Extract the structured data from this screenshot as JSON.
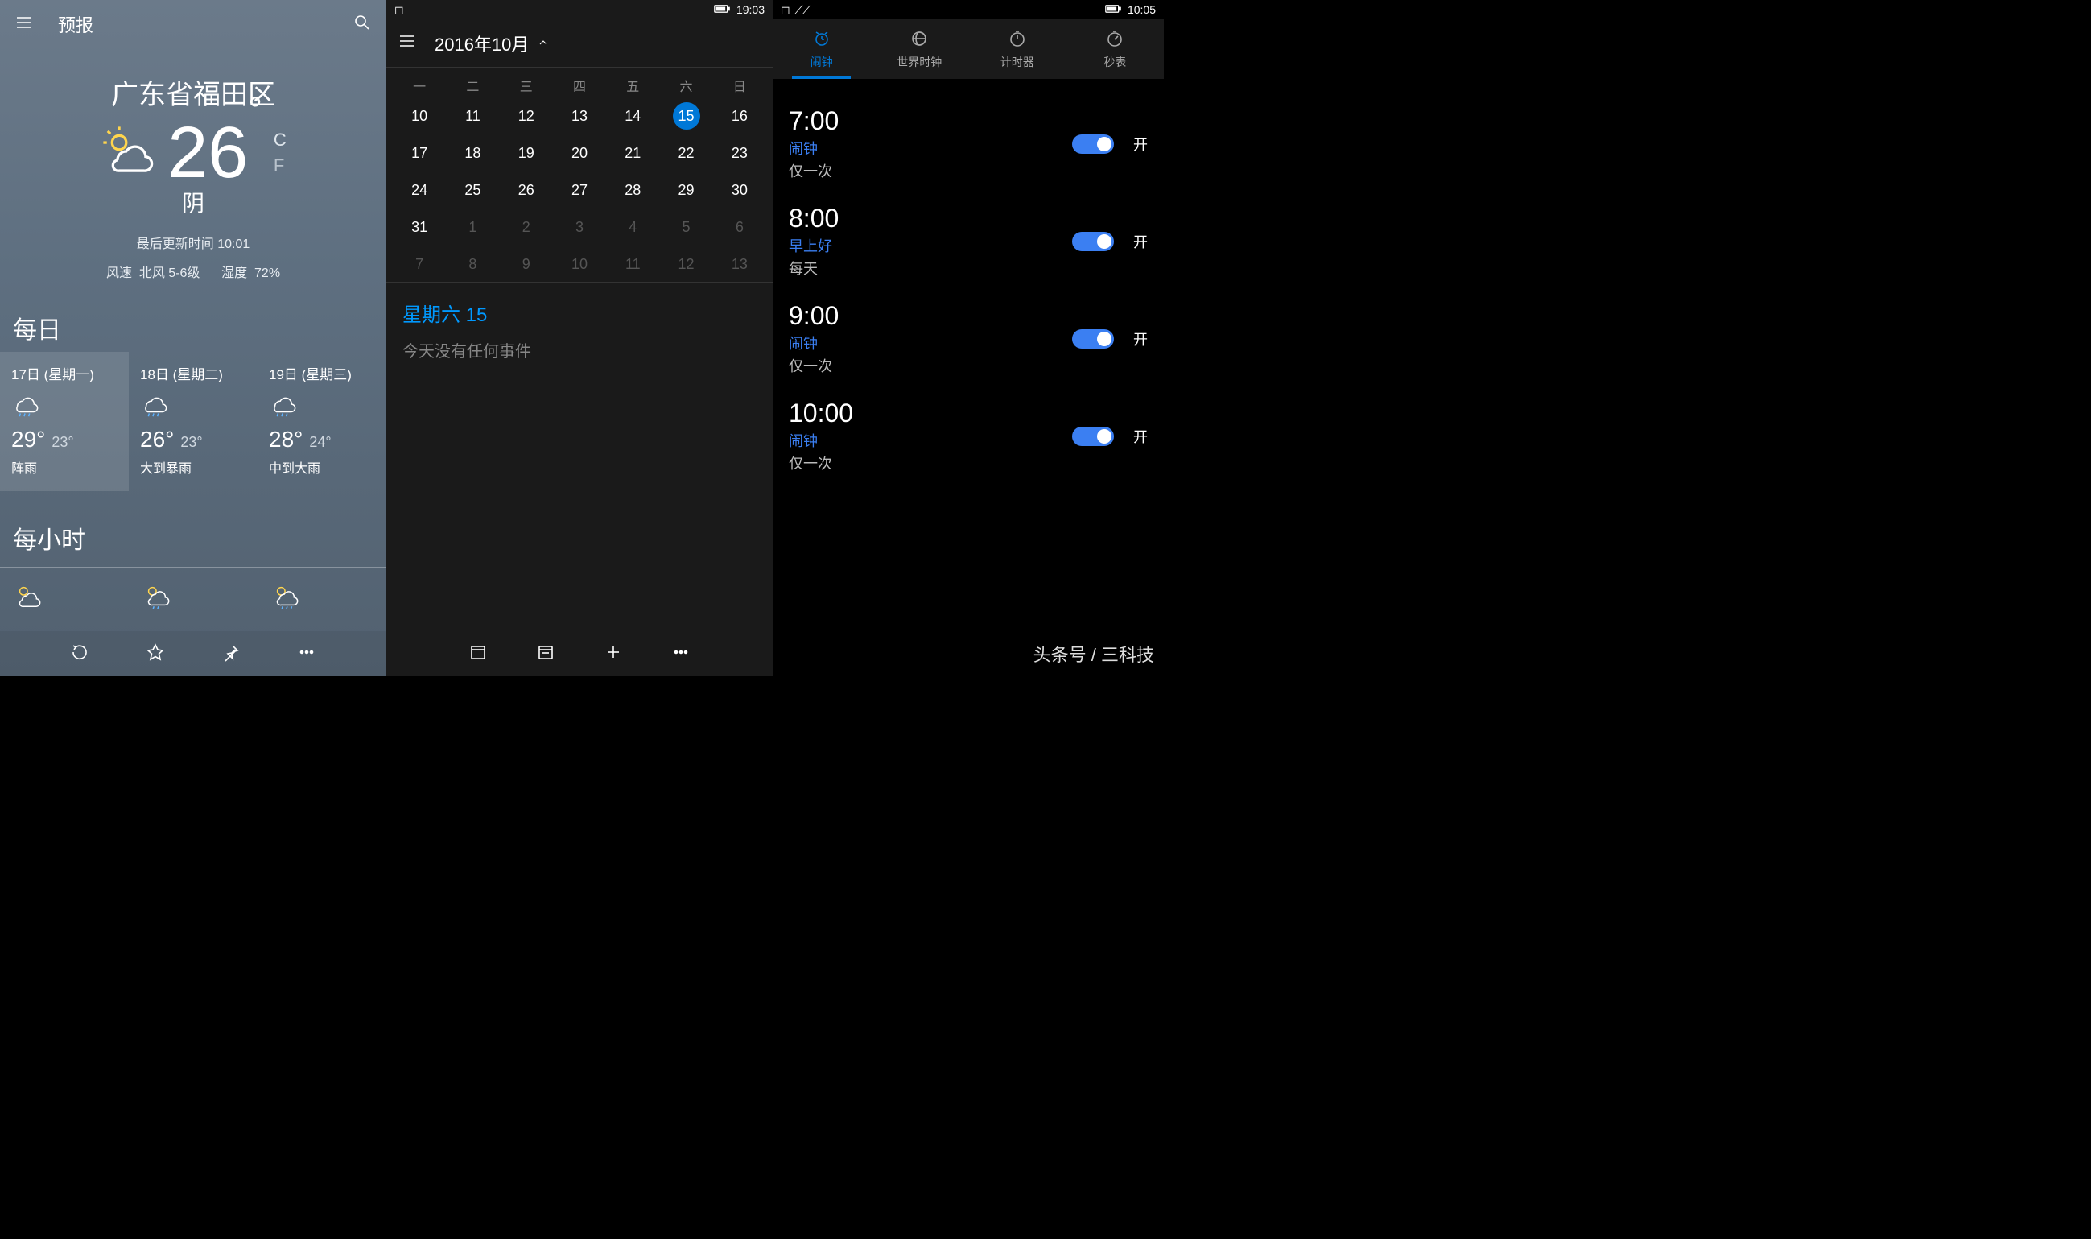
{
  "weather": {
    "header_title": "预报",
    "location": "广东省福田区",
    "temp": "26",
    "unit_c": "C",
    "unit_f": "F",
    "condition": "阴",
    "updated": "最后更新时间 10:01",
    "wind_label": "风速",
    "wind_value": "北风 5-6级",
    "humidity_label": "湿度",
    "humidity_value": "72%",
    "daily_title": "每日",
    "days": [
      {
        "date": "17日 (星期一)",
        "hi": "29°",
        "lo": "23°",
        "cond": "阵雨"
      },
      {
        "date": "18日 (星期二)",
        "hi": "26°",
        "lo": "23°",
        "cond": "大到暴雨"
      },
      {
        "date": "19日 (星期三)",
        "hi": "28°",
        "lo": "24°",
        "cond": "中到大雨"
      }
    ],
    "hourly_title": "每小时"
  },
  "calendar": {
    "status_time": "19:03",
    "title": "2016年10月",
    "weekdays": [
      "一",
      "二",
      "三",
      "四",
      "五",
      "六",
      "日"
    ],
    "cells": [
      {
        "n": "10"
      },
      {
        "n": "11"
      },
      {
        "n": "12"
      },
      {
        "n": "13"
      },
      {
        "n": "14"
      },
      {
        "n": "15",
        "today": true
      },
      {
        "n": "16"
      },
      {
        "n": "17"
      },
      {
        "n": "18"
      },
      {
        "n": "19"
      },
      {
        "n": "20"
      },
      {
        "n": "21"
      },
      {
        "n": "22"
      },
      {
        "n": "23"
      },
      {
        "n": "24"
      },
      {
        "n": "25"
      },
      {
        "n": "26"
      },
      {
        "n": "27"
      },
      {
        "n": "28"
      },
      {
        "n": "29"
      },
      {
        "n": "30"
      },
      {
        "n": "31"
      },
      {
        "n": "1",
        "dim": true
      },
      {
        "n": "2",
        "dim": true
      },
      {
        "n": "3",
        "dim": true
      },
      {
        "n": "4",
        "dim": true
      },
      {
        "n": "5",
        "dim": true
      },
      {
        "n": "6",
        "dim": true
      },
      {
        "n": "7",
        "dim": true
      },
      {
        "n": "8",
        "dim": true
      },
      {
        "n": "9",
        "dim": true
      },
      {
        "n": "10",
        "dim": true
      },
      {
        "n": "11",
        "dim": true
      },
      {
        "n": "12",
        "dim": true
      },
      {
        "n": "13",
        "dim": true
      }
    ],
    "agenda_day": "星期六 15",
    "agenda_empty": "今天没有任何事件"
  },
  "alarms": {
    "status_time": "10:05",
    "tabs": [
      {
        "label": "闹钟",
        "active": true
      },
      {
        "label": "世界时钟"
      },
      {
        "label": "计时器"
      },
      {
        "label": "秒表"
      }
    ],
    "items": [
      {
        "time": "7:00",
        "label": "闹钟",
        "repeat": "仅一次",
        "on_label": "开"
      },
      {
        "time": "8:00",
        "label": "早上好",
        "repeat": "每天",
        "on_label": "开"
      },
      {
        "time": "9:00",
        "label": "闹钟",
        "repeat": "仅一次",
        "on_label": "开"
      },
      {
        "time": "10:00",
        "label": "闹钟",
        "repeat": "仅一次",
        "on_label": "开"
      }
    ]
  },
  "watermark": "头条号 / 三科技"
}
